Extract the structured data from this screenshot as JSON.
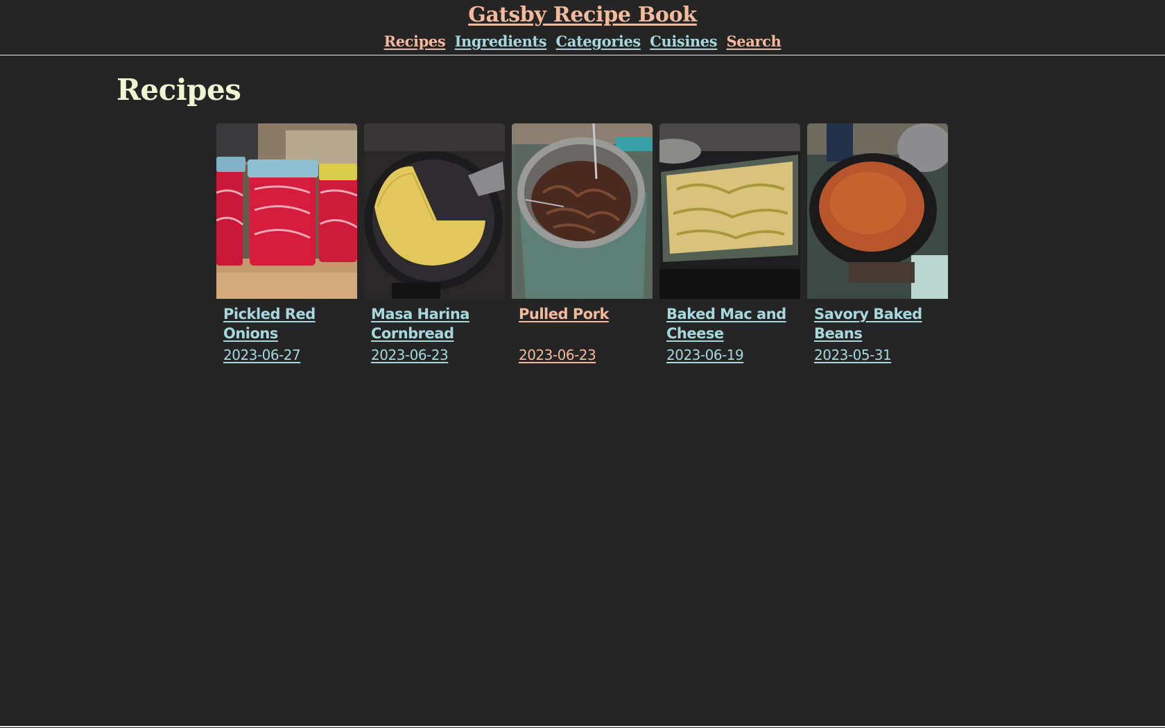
{
  "colors": {
    "background": "#252525",
    "link_peach": "#f5b99b",
    "link_blue": "#a6d8dd",
    "heading": "#eef7d2",
    "divider": "#e9e9e9"
  },
  "header": {
    "site_title": "Gatsby Recipe Book",
    "nav": [
      {
        "label": "Recipes",
        "color": "#f5b99b"
      },
      {
        "label": "Ingredients",
        "color": "#a6d8dd"
      },
      {
        "label": "Categories",
        "color": "#a6d8dd"
      },
      {
        "label": "Cuisines",
        "color": "#a6d8dd"
      },
      {
        "label": "Search",
        "color": "#f5b99b"
      }
    ]
  },
  "main": {
    "title": "Recipes",
    "recipes": [
      {
        "name": "Pickled Red Onions",
        "date": "2023-06-27",
        "color": "#a6d8dd",
        "image": "pickled-red-onions-photo"
      },
      {
        "name": "Masa Harina Cornbread",
        "date": "2023-06-23",
        "color": "#a6d8dd",
        "image": "masa-harina-cornbread-photo"
      },
      {
        "name": "Pulled Pork",
        "date": "2023-06-23",
        "color": "#f5b99b",
        "image": "pulled-pork-photo"
      },
      {
        "name": "Baked Mac and Cheese",
        "date": "2023-06-19",
        "color": "#a6d8dd",
        "image": "baked-mac-and-cheese-photo"
      },
      {
        "name": "Savory Baked Beans",
        "date": "2023-05-31",
        "color": "#a6d8dd",
        "image": "savory-baked-beans-photo"
      }
    ]
  }
}
